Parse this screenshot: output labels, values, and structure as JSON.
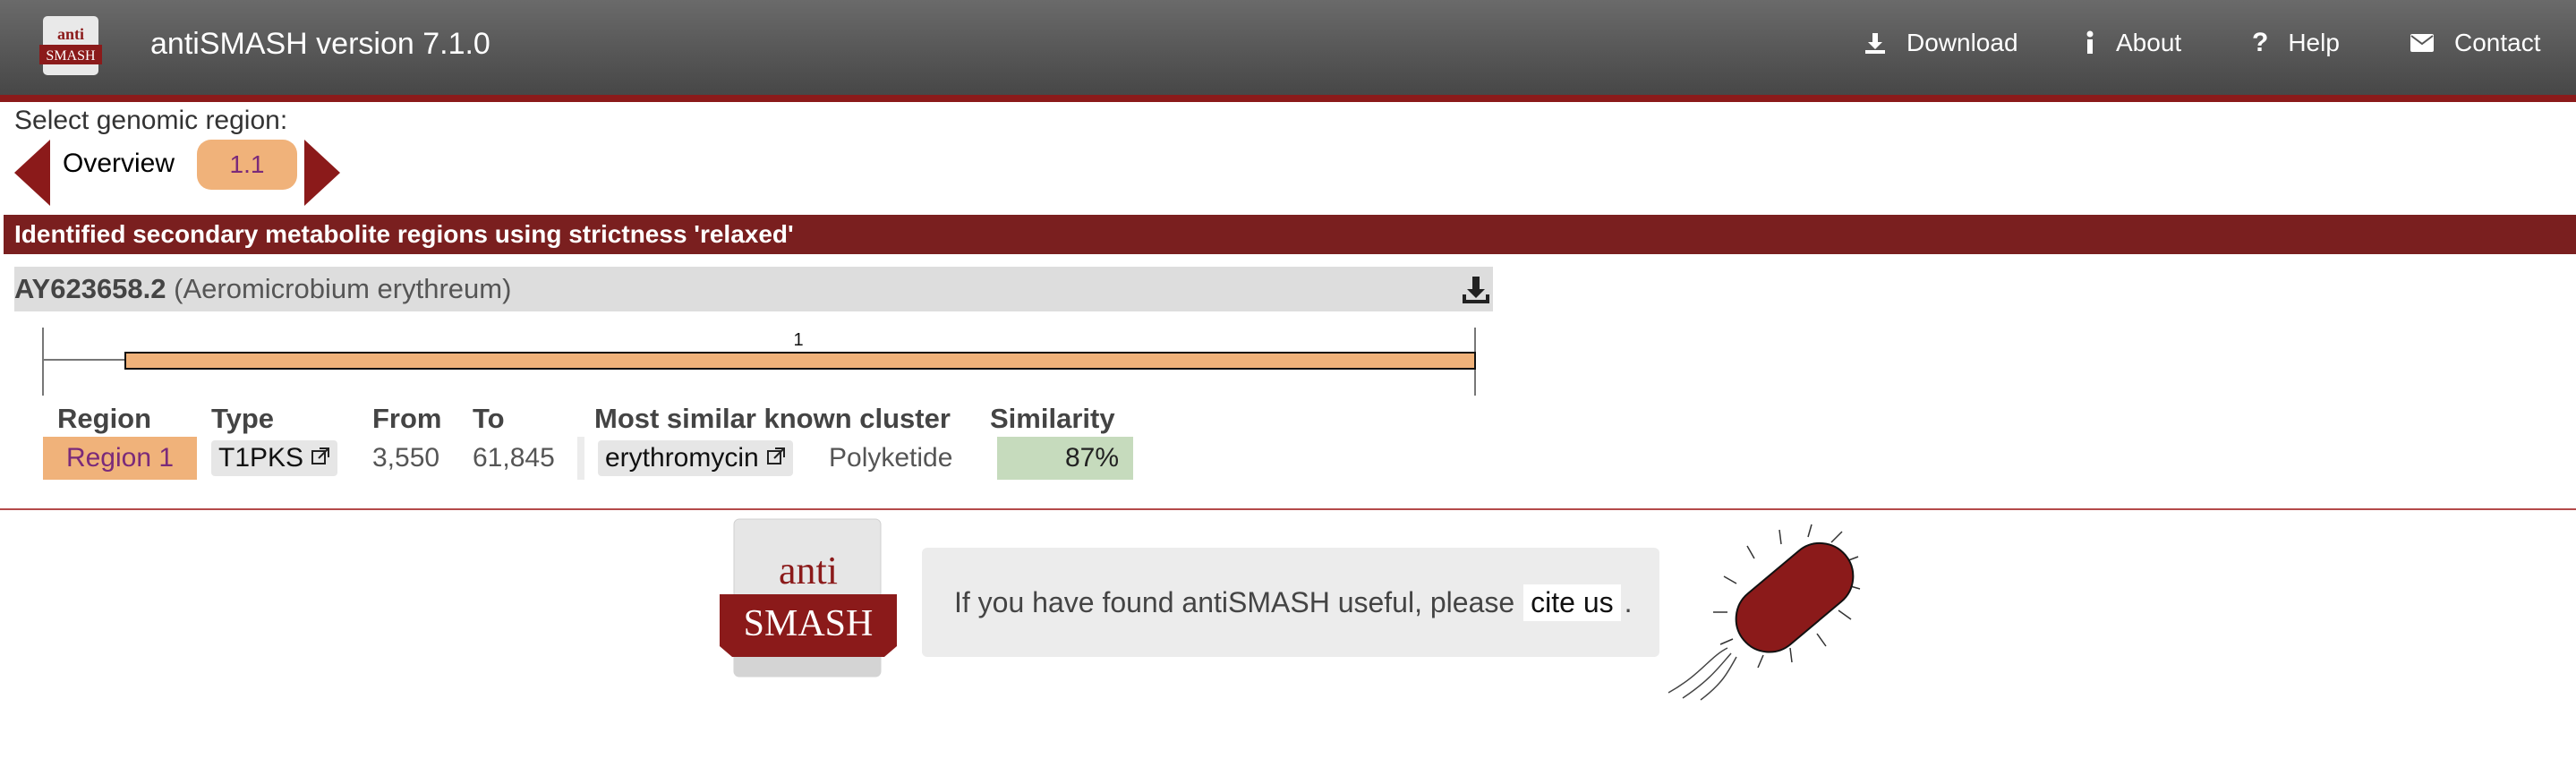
{
  "header": {
    "logo_text_top": "anti",
    "logo_text_bottom": "SMASH",
    "title": "antiSMASH version 7.1.0",
    "nav": [
      {
        "label": "Download",
        "icon": "download-icon"
      },
      {
        "label": "About",
        "icon": "info-icon"
      },
      {
        "label": "Help",
        "icon": "help-icon"
      },
      {
        "label": "Contact",
        "icon": "mail-icon"
      }
    ]
  },
  "region_selector": {
    "label": "Select genomic region:",
    "tabs": [
      "Overview",
      "1.1"
    ]
  },
  "heading": "Identified secondary metabolite regions using strictness 'relaxed'",
  "record": {
    "id": "AY623658.2",
    "organism": "(Aeromicrobium erythreum)",
    "region_marker": "1"
  },
  "table": {
    "headers": [
      "Region",
      "Type",
      "From",
      "To",
      "Most similar known cluster",
      "Similarity"
    ],
    "rows": [
      {
        "region": "Region 1",
        "type": "T1PKS",
        "from": "3,550",
        "to": "61,845",
        "cluster": "erythromycin",
        "cluster_type": "Polyketide",
        "similarity": "87%"
      }
    ]
  },
  "footer": {
    "logo_top": "anti",
    "logo_bottom": "SMASH",
    "cite_text": "If you have found antiSMASH useful, please",
    "cite_link": "cite us",
    "cite_end": "."
  },
  "colors": {
    "brand_red": "#8b1a1a",
    "region_orange": "#f0b27a",
    "similarity_green": "#c6dbbd"
  }
}
